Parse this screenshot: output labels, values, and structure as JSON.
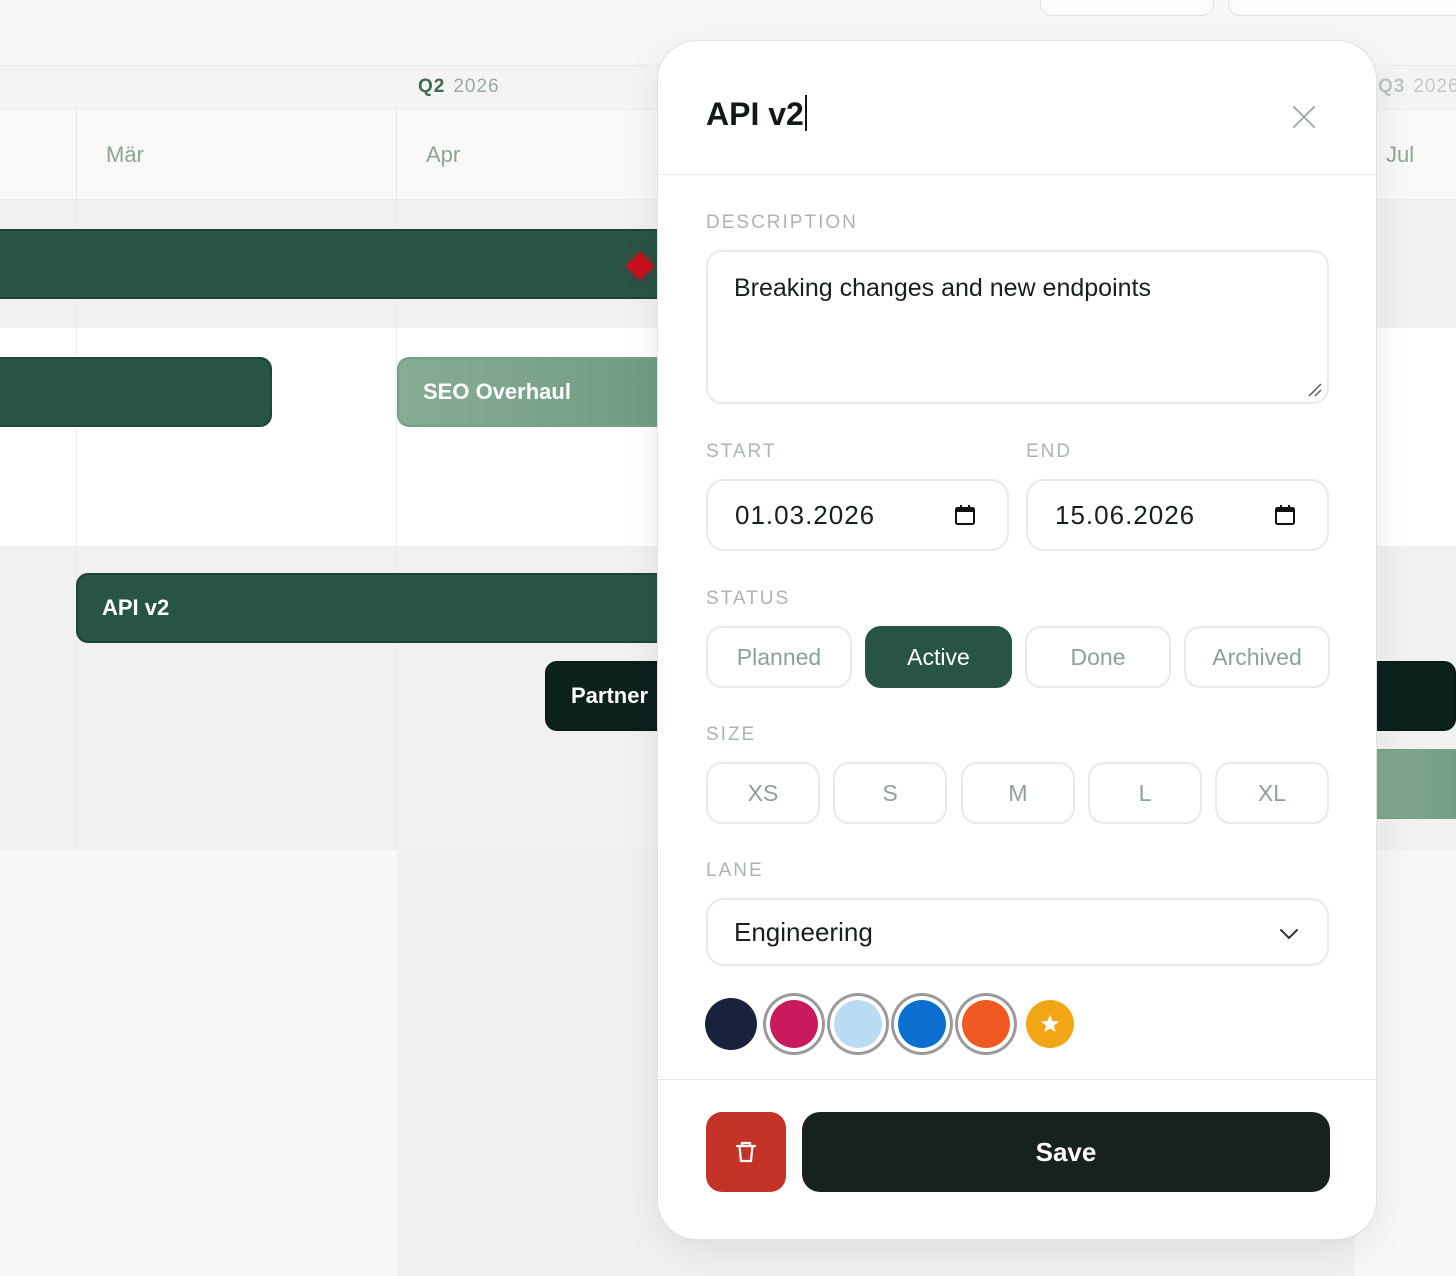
{
  "timeline": {
    "quarters": [
      {
        "q": "Q2",
        "year": "2026"
      },
      {
        "q": "Q3",
        "year": "2026"
      }
    ],
    "months": [
      "Mär",
      "Apr",
      "Jul"
    ],
    "bars": [
      {
        "label": ""
      },
      {
        "label": ""
      },
      {
        "label": "SEO Overhaul"
      },
      {
        "label": "API v2"
      },
      {
        "label": "Partner"
      }
    ]
  },
  "editor": {
    "title": "API v2",
    "description_label": "DESCRIPTION",
    "description": "Breaking changes and new endpoints",
    "start_label": "START",
    "start_value": "01.03.2026",
    "end_label": "END",
    "end_value": "15.06.2026",
    "status_label": "STATUS",
    "status_options": [
      "Planned",
      "Active",
      "Done",
      "Archived"
    ],
    "status_selected": "Active",
    "size_label": "SIZE",
    "size_options": [
      "XS",
      "S",
      "M",
      "L",
      "XL"
    ],
    "lane_label": "LANE",
    "lane_value": "Engineering",
    "colors": [
      "#18223a",
      "#c81a5c",
      "#b9dcf2",
      "#0a6fd1",
      "#f05a22",
      "#f2a615"
    ],
    "save_label": "Save",
    "accent": "#285446",
    "danger": "#c43328"
  }
}
